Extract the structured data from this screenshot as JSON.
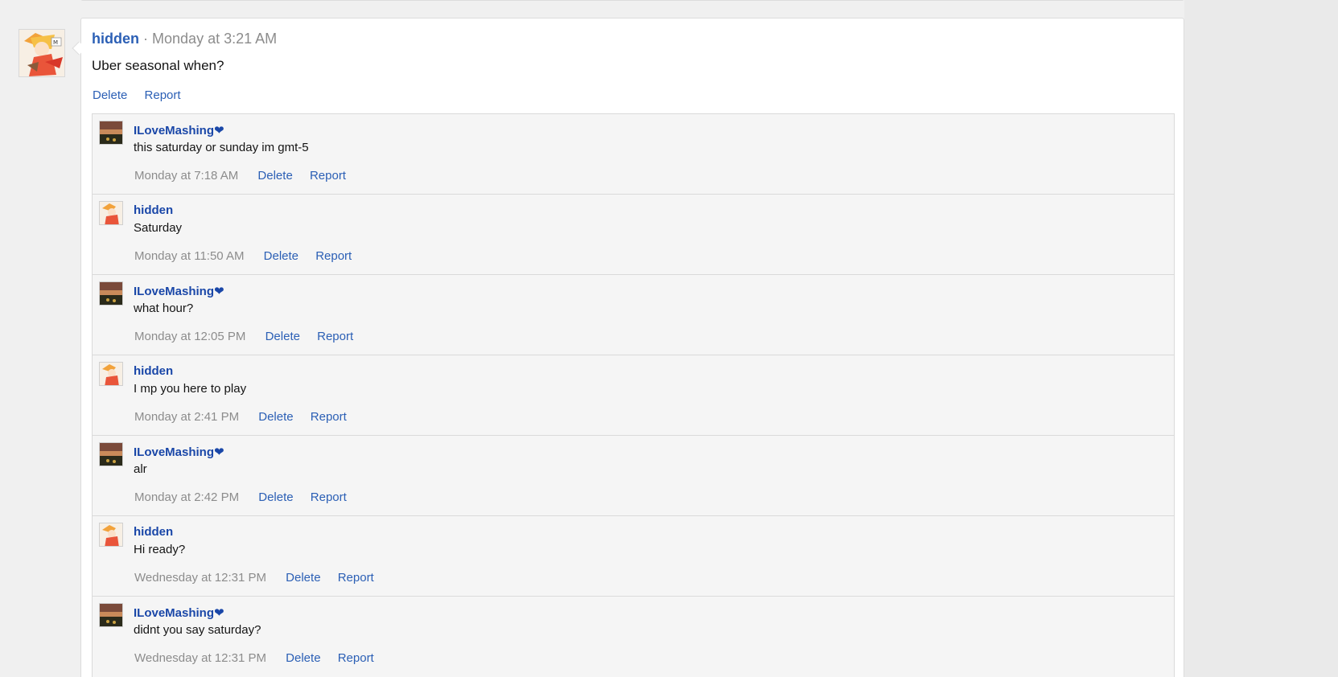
{
  "post": {
    "author": "hidden",
    "separator": "·",
    "time": "Monday at 3:21 AM",
    "body": "Uber seasonal when?",
    "delete_label": "Delete",
    "report_label": "Report"
  },
  "comments": [
    {
      "author": "ILoveMashing",
      "heart": "❤",
      "text": "this saturday or sunday im gmt-5",
      "time": "Monday at 7:18 AM",
      "delete_label": "Delete",
      "report_label": "Report",
      "avatar": "sunset-avatar"
    },
    {
      "author": "hidden",
      "heart": "",
      "text": "Saturday",
      "time": "Monday at 11:50 AM",
      "delete_label": "Delete",
      "report_label": "Report",
      "avatar": "anime-avatar"
    },
    {
      "author": "ILoveMashing",
      "heart": "❤",
      "text": "what hour?",
      "time": "Monday at 12:05 PM",
      "delete_label": "Delete",
      "report_label": "Report",
      "avatar": "sunset-avatar"
    },
    {
      "author": "hidden",
      "heart": "",
      "text": "I mp you here to play",
      "time": "Monday at 2:41 PM",
      "delete_label": "Delete",
      "report_label": "Report",
      "avatar": "anime-avatar"
    },
    {
      "author": "ILoveMashing",
      "heart": "❤",
      "text": "alr",
      "time": "Monday at 2:42 PM",
      "delete_label": "Delete",
      "report_label": "Report",
      "avatar": "sunset-avatar"
    },
    {
      "author": "hidden",
      "heart": "",
      "text": "Hi ready?",
      "time": "Wednesday at 12:31 PM",
      "delete_label": "Delete",
      "report_label": "Report",
      "avatar": "anime-avatar"
    },
    {
      "author": "ILoveMashing",
      "heart": "❤",
      "text": "didnt you say saturday?",
      "time": "Wednesday at 12:31 PM",
      "delete_label": "Delete",
      "report_label": "Report",
      "avatar": "sunset-avatar"
    }
  ],
  "colors": {
    "link": "#2b5fb5",
    "author": "#1a47a8",
    "muted": "#8c8c8c",
    "comment_bg": "#f5f5f5"
  }
}
